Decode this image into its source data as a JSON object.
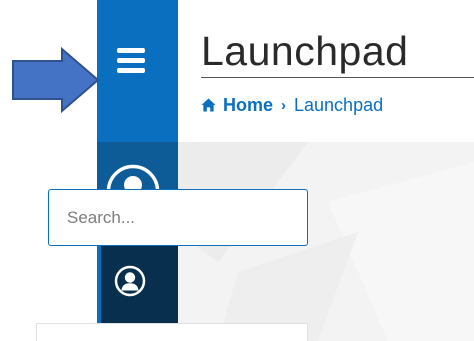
{
  "header": {
    "title": "Launchpad"
  },
  "breadcrumb": {
    "home_label": "Home",
    "separator": "›",
    "current_label": "Launchpad"
  },
  "search": {
    "placeholder": "Search...",
    "value": ""
  },
  "icons": {
    "menu": "hamburger-menu-icon",
    "profile": "user-avatar-icon",
    "nav_item": "user-circle-icon",
    "home": "home-icon",
    "annotation": "right-arrow-icon"
  },
  "colors": {
    "sidebar_top": "#0a6fbf",
    "sidebar_profile": "#0e5c97",
    "sidebar_dark": "#082f4d",
    "accent": "#0a6fbf",
    "arrow_fill": "#4472c4",
    "arrow_stroke": "#2f528f"
  }
}
